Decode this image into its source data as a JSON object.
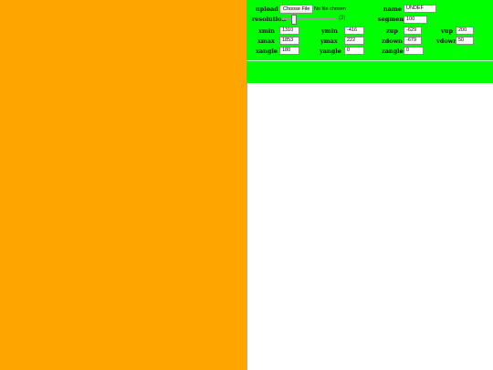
{
  "upload": {
    "label": "upload",
    "button": "Choose File",
    "status": "No file chosen"
  },
  "name": {
    "label": "name",
    "value": "UNDEF"
  },
  "resolution": {
    "label": "resolution",
    "display": "(3)",
    "slider_fraction": 0.2
  },
  "segments": {
    "label": "segments",
    "value": "100"
  },
  "fields": {
    "xmin": {
      "label": "xmin",
      "value": "1310"
    },
    "ymin": {
      "label": "ymin",
      "value": "-416"
    },
    "zup": {
      "label": "zup",
      "value": "-629"
    },
    "vup": {
      "label": "vup",
      "value": "200"
    },
    "xmax": {
      "label": "xmax",
      "value": "1853"
    },
    "ymax": {
      "label": "ymax",
      "value": "222"
    },
    "zdown": {
      "label": "zdown",
      "value": "-679"
    },
    "vdown": {
      "label": "vdown",
      "value": "50"
    },
    "xangle": {
      "label": "xangle",
      "value": "180"
    },
    "yangle": {
      "label": "yangle",
      "value": "0"
    },
    "zangle": {
      "label": "zangle",
      "value": "0"
    }
  },
  "colors": {
    "left_pane": "#ffa500",
    "controls_bg": "#00ff00",
    "viewport_bg": "#ffffff"
  }
}
